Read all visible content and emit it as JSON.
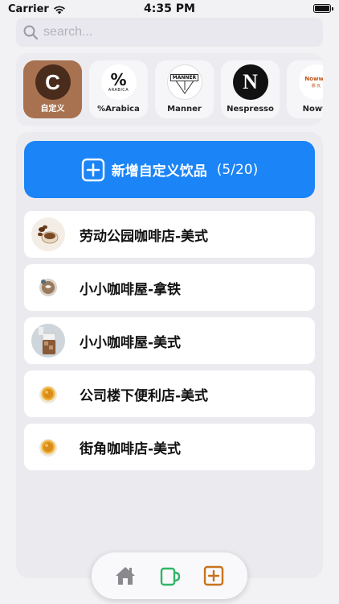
{
  "status_bar": {
    "carrier": "Carrier",
    "time": "4:35 PM",
    "wifi_icon": "wifi-icon",
    "battery_icon": "battery-icon"
  },
  "search": {
    "placeholder": "search...",
    "value": "",
    "icon": "search-icon"
  },
  "brands": [
    {
      "name": "自定义",
      "logo_text": "C",
      "selected": true
    },
    {
      "name": "%Arabica",
      "logo_text": "%",
      "logo_subtext": "ARABICA",
      "selected": false
    },
    {
      "name": "Manner",
      "logo_text": "MANNER",
      "selected": false
    },
    {
      "name": "Nespresso",
      "logo_text": "N",
      "selected": false
    },
    {
      "name": "Noww",
      "logo_text": "Nowwa",
      "logo_subtext": "挪 瓦",
      "selected": false
    }
  ],
  "add_button": {
    "label": "新增自定义饮品",
    "count": "(5/20)",
    "icon": "plus-square-icon"
  },
  "drinks": [
    {
      "label": "劳动公园咖啡店-美式",
      "thumb": "coffee-beans-cup"
    },
    {
      "label": "小小咖啡屋-拿铁",
      "thumb": "latte-cup"
    },
    {
      "label": "小小咖啡屋-美式",
      "thumb": "iced-coffee-glass"
    },
    {
      "label": "公司楼下便利店-美式",
      "thumb": "coffee-cup-topview"
    },
    {
      "label": "街角咖啡店-美式",
      "thumb": "coffee-cup-topview"
    }
  ],
  "tab_bar": {
    "tabs": [
      {
        "icon": "home-icon",
        "color": "#8a8a8e"
      },
      {
        "icon": "mug-icon",
        "color": "#2fb567"
      },
      {
        "icon": "plus-square-icon",
        "color": "#c8731d"
      }
    ]
  },
  "colors": {
    "accent_blue": "#1b84f7",
    "selected_brand": "#a87250",
    "mug_green": "#2fb567",
    "add_orange": "#c8731d"
  }
}
